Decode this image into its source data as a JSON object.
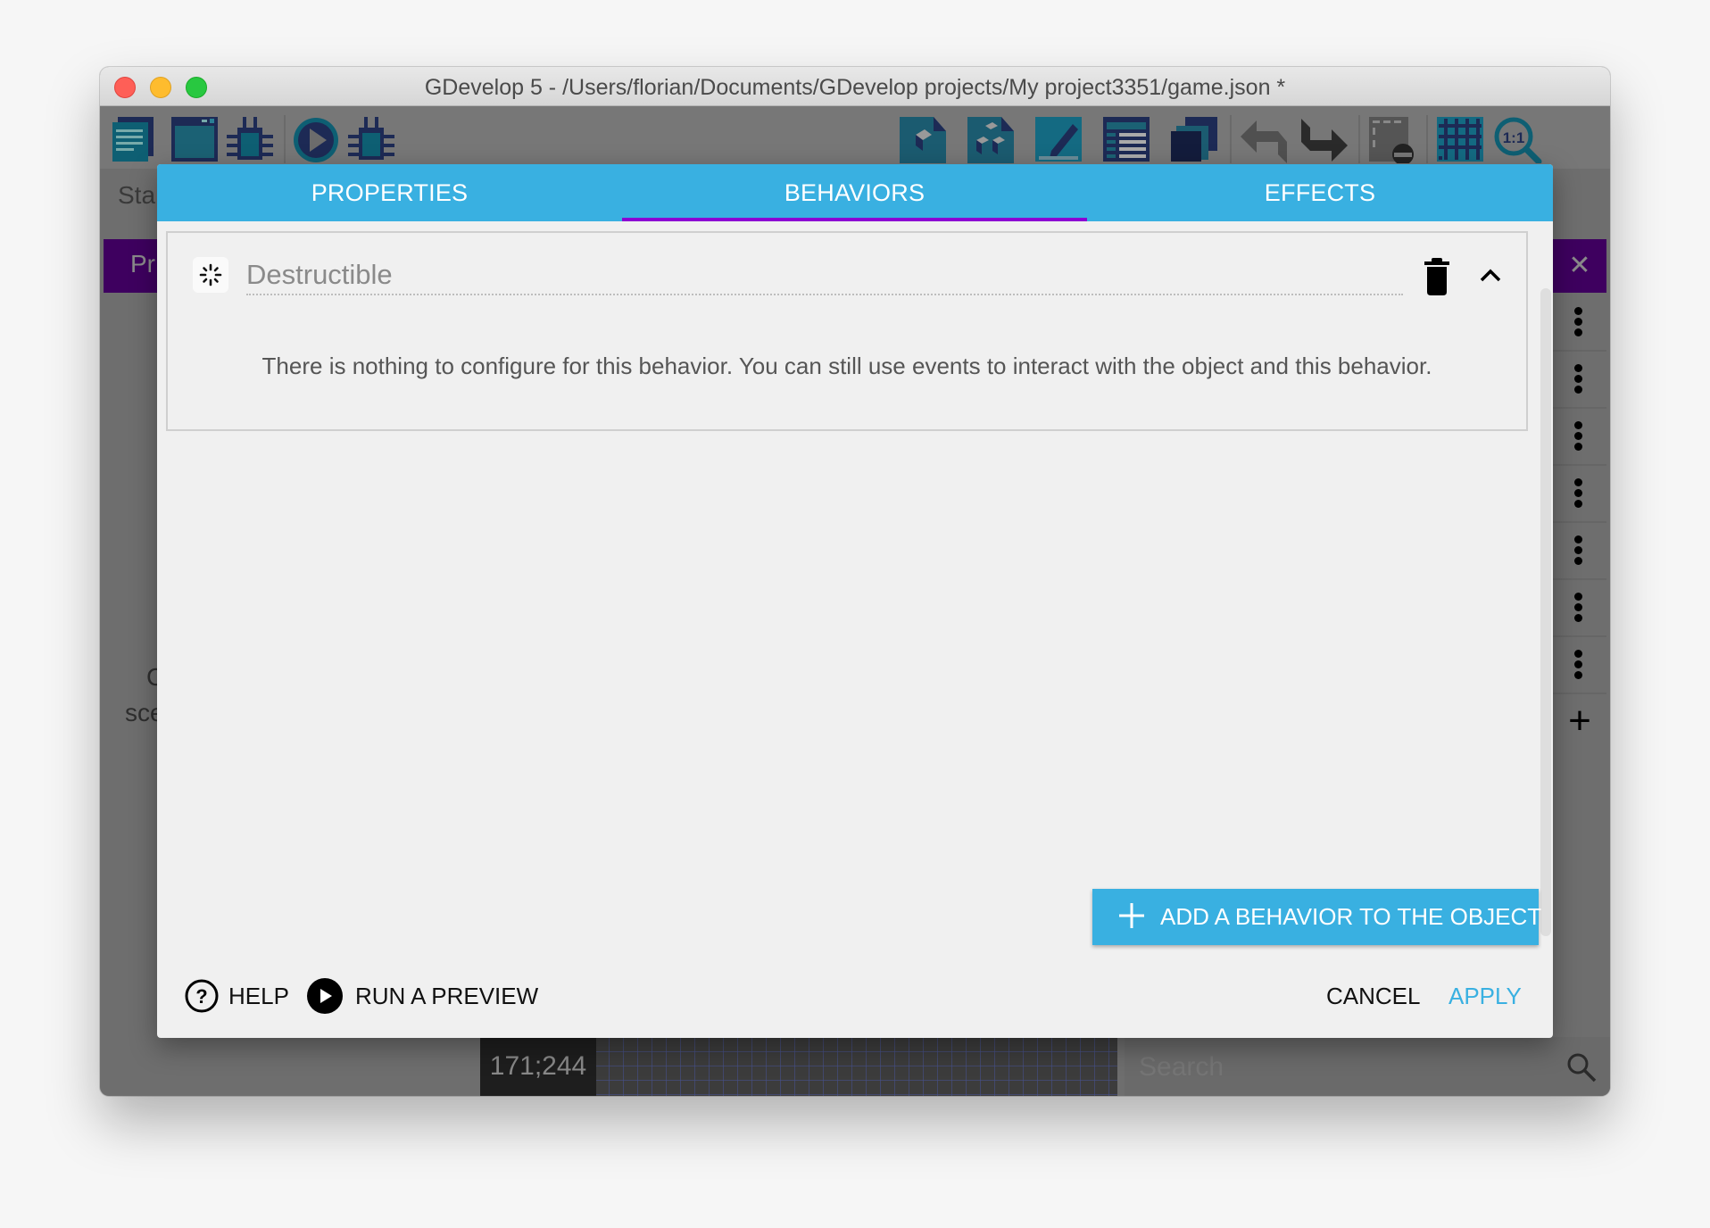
{
  "window": {
    "title": "GDevelop 5 - /Users/florian/Documents/GDevelop projects/My project3351/game.json *",
    "traffic_lights": [
      "close",
      "minimize",
      "maximize"
    ]
  },
  "toolbar": {
    "left_icons": [
      "project-manager-icon",
      "scene-icon",
      "debugger-icon",
      "preview-icon",
      "network-debugger-icon"
    ],
    "right_icons": [
      "objects-panel-icon",
      "object-groups-icon",
      "properties-panel-icon",
      "instances-list-icon",
      "layers-icon",
      "undo-icon",
      "redo-icon",
      "window-mask-icon",
      "grid-icon",
      "zoom-reset-icon"
    ],
    "zoom_reset_label": "1:1"
  },
  "background": {
    "start_tab_partial": "Sta",
    "purple_tab_partial": "Pr",
    "center_text_line1_partial": "C",
    "center_text_line2_partial": "sce",
    "coordinates": "171;244",
    "search_placeholder": "Search",
    "side_list_rows": 7
  },
  "dialog": {
    "tabs": [
      {
        "label": "PROPERTIES",
        "active": false
      },
      {
        "label": "BEHAVIORS",
        "active": true
      },
      {
        "label": "EFFECTS",
        "active": false
      }
    ],
    "behaviors": [
      {
        "name": "Destructible",
        "icon": "destructible-icon",
        "expanded": true,
        "description": "There is nothing to configure for this behavior. You can still use events to interact with the object and this behavior."
      }
    ],
    "add_behavior_label": "ADD A BEHAVIOR TO THE OBJECT",
    "actions": {
      "help": "HELP",
      "run_preview": "RUN A PREVIEW",
      "cancel": "CANCEL",
      "apply": "APPLY"
    }
  },
  "colors": {
    "accent": "#39b0e1",
    "tab_indicator": "#8b00d3",
    "background_purple": "#3e005f"
  }
}
